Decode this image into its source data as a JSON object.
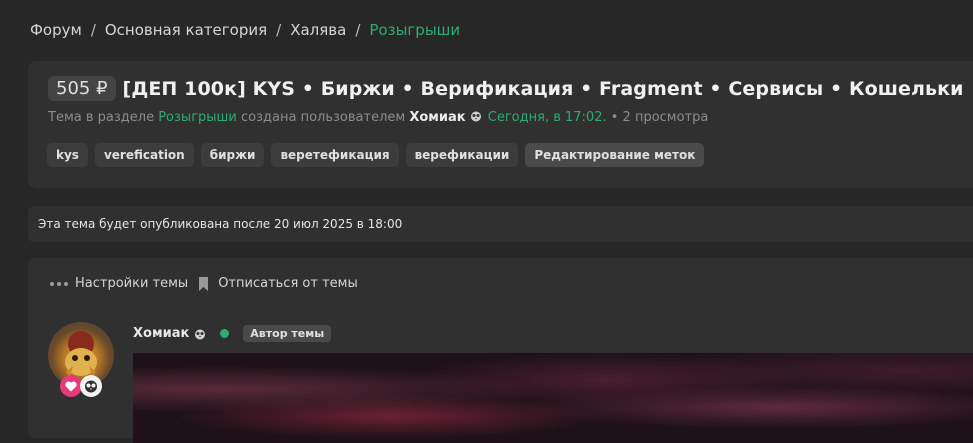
{
  "breadcrumbs": [
    "Форум",
    "Основная категория",
    "Халява",
    "Розыгрыши"
  ],
  "breadcrumb_separator": "/",
  "thread": {
    "price": "505 ₽",
    "title": "[ДЕП 100к] KYS • Биржи • Верификация • Fragment • Сервисы • Кошельки",
    "meta": {
      "prefix": "Тема в разделе",
      "section": "Розыгрыши",
      "created_by": "создана пользователем",
      "author": "Хомиак",
      "date": "Сегодня, в 17:02.",
      "views": "• 2 просмотра"
    },
    "tags": [
      "kys",
      "verefication",
      "биржи",
      "веретефикация",
      "верефикации"
    ],
    "edit_tags_label": "Редактирование меток"
  },
  "notice": {
    "text": "Эта тема будет опубликована после 20 июл 2025 в 18:00"
  },
  "post": {
    "actions": {
      "settings_label": "Настройки темы",
      "unsubscribe_label": "Отписаться от темы"
    },
    "author": {
      "name": "Хомиак",
      "badge": "Автор темы",
      "online": true
    }
  },
  "colors": {
    "accent_green": "#2bad72",
    "background": "#272727",
    "panel": "#303030",
    "heart_badge": "#e63b7a"
  },
  "icons": [
    "dots-icon",
    "bookmark-icon",
    "owl-icon",
    "heart-icon",
    "online-dot-icon"
  ]
}
